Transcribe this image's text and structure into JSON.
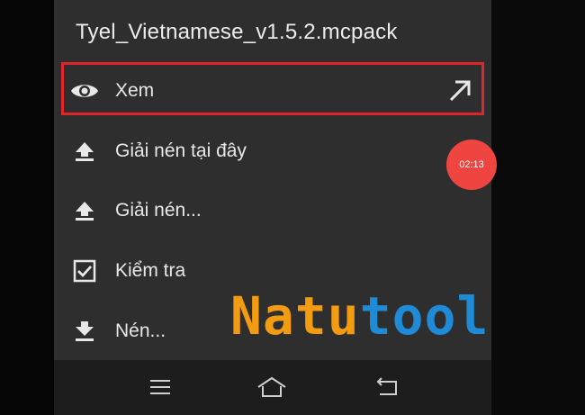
{
  "dialog": {
    "title": "Tyel_Vietnamese_v1.5.2.mcpack",
    "items": [
      {
        "label": "Xem",
        "icon": "eye-icon",
        "selected": true
      },
      {
        "label": "Giải nén tại đây",
        "icon": "upload-icon"
      },
      {
        "label": "Giải nén...",
        "icon": "upload-icon"
      },
      {
        "label": "Kiểm tra",
        "icon": "checkbox-icon"
      },
      {
        "label": "Nén...",
        "icon": "download-icon"
      }
    ],
    "highlight_color": "#e0262b"
  },
  "timer": {
    "text": "02:13",
    "color": "#ee4540"
  },
  "navbar": {
    "buttons": [
      "menu-icon",
      "home-icon",
      "back-icon"
    ]
  },
  "watermark": {
    "part1": "Natu",
    "part2": "tool",
    "color1": "#f39c12",
    "color2": "#1f8ad6"
  }
}
